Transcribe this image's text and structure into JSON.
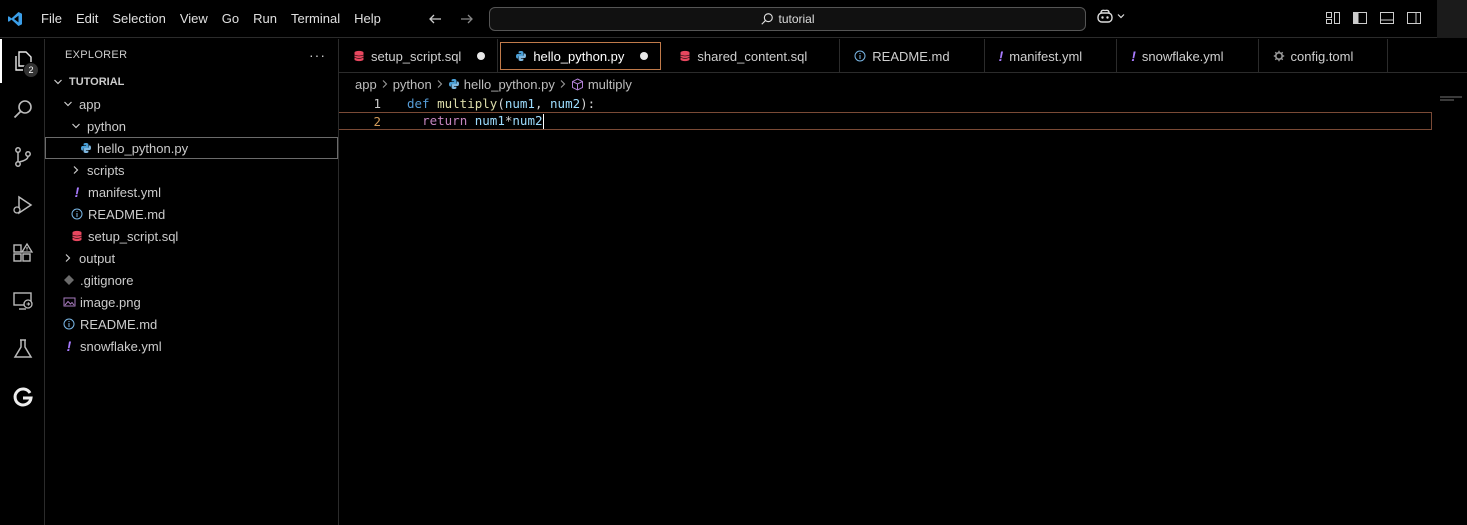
{
  "titlebar": {
    "menu": [
      "File",
      "Edit",
      "Selection",
      "View",
      "Go",
      "Run",
      "Terminal",
      "Help"
    ],
    "search_text": "tutorial"
  },
  "activity": {
    "explorer_badge": "2"
  },
  "sidebar": {
    "title": "EXPLORER",
    "more": "···",
    "tree": [
      {
        "label": "TUTORIAL",
        "type": "root",
        "depth": 0
      },
      {
        "label": "app",
        "type": "folder-open",
        "depth": 1
      },
      {
        "label": "python",
        "type": "folder-open",
        "depth": 2
      },
      {
        "label": "hello_python.py",
        "type": "python",
        "depth": 3
      },
      {
        "label": "scripts",
        "type": "folder-closed",
        "depth": 2
      },
      {
        "label": "manifest.yml",
        "type": "yaml",
        "depth": 2
      },
      {
        "label": "README.md",
        "type": "info",
        "depth": 2
      },
      {
        "label": "setup_script.sql",
        "type": "sql",
        "depth": 2
      },
      {
        "label": "output",
        "type": "folder-closed",
        "depth": 1
      },
      {
        "label": ".gitignore",
        "type": "git",
        "depth": 1
      },
      {
        "label": "image.png",
        "type": "image",
        "depth": 1
      },
      {
        "label": "README.md",
        "type": "info",
        "depth": 1
      },
      {
        "label": "snowflake.yml",
        "type": "yaml",
        "depth": 1
      }
    ]
  },
  "tabs": [
    {
      "label": "setup_script.sql",
      "type": "sql",
      "modified": true,
      "active": false
    },
    {
      "label": "hello_python.py",
      "type": "python",
      "modified": true,
      "active": true
    },
    {
      "label": "shared_content.sql",
      "type": "sql",
      "modified": false,
      "active": false
    },
    {
      "label": "README.md",
      "type": "info",
      "modified": false,
      "active": false
    },
    {
      "label": "manifest.yml",
      "type": "yaml",
      "modified": false,
      "active": false
    },
    {
      "label": "snowflake.yml",
      "type": "yaml",
      "modified": false,
      "active": false
    },
    {
      "label": "config.toml",
      "type": "gear",
      "modified": false,
      "active": false
    }
  ],
  "breadcrumb": [
    "app",
    "python",
    "hello_python.py",
    "multiply"
  ],
  "editor": {
    "lines": [
      {
        "number": "1",
        "tokens": [
          [
            "kw",
            "def"
          ],
          [
            "plain",
            " "
          ],
          [
            "fn",
            "multiply"
          ],
          [
            "plain",
            "("
          ],
          [
            "pn",
            "num1"
          ],
          [
            "plain",
            ", "
          ],
          [
            "pn",
            "num2"
          ],
          [
            "plain",
            "):"
          ]
        ]
      },
      {
        "number": "2",
        "tokens": [
          [
            "plain",
            "  "
          ],
          [
            "kw2",
            "return"
          ],
          [
            "plain",
            " "
          ],
          [
            "pn",
            "num1"
          ],
          [
            "plain",
            "*"
          ],
          [
            "pn",
            "num2"
          ]
        ]
      }
    ]
  },
  "colors": {
    "python_icon": "#4a9fd6",
    "sql_icon": "#e8475f",
    "yaml_icon": "#a97bff",
    "info_icon": "#7ab7e6",
    "active_tab_border": "#c07a4a"
  }
}
